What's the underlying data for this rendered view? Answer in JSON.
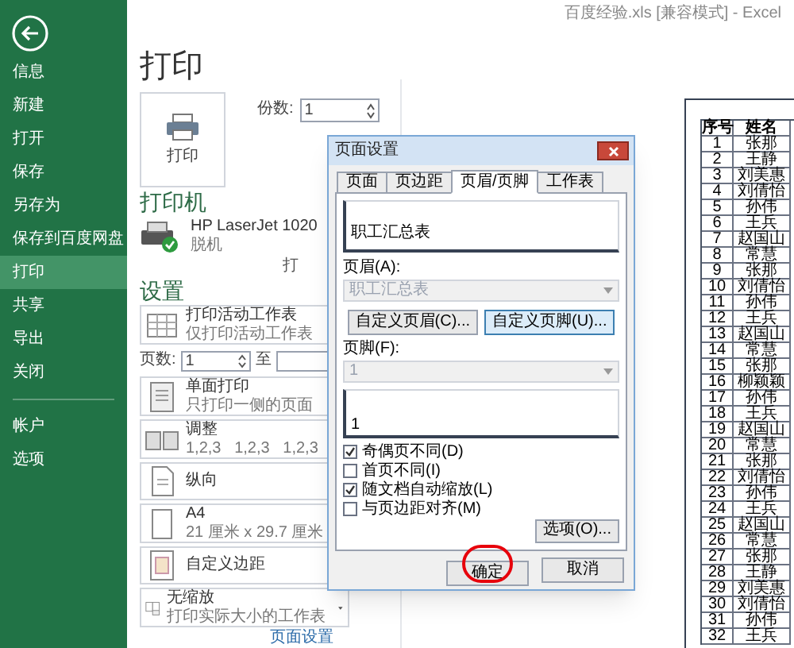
{
  "window": {
    "title": "百度经验.xls [兼容模式] - Excel"
  },
  "backstage_nav": {
    "items": [
      {
        "label": "信息",
        "selected": false
      },
      {
        "label": "新建",
        "selected": false
      },
      {
        "label": "打开",
        "selected": false
      },
      {
        "label": "保存",
        "selected": false
      },
      {
        "label": "另存为",
        "selected": false
      },
      {
        "label": "保存到百度网盘",
        "selected": false
      },
      {
        "label": "打印",
        "selected": true
      },
      {
        "label": "共享",
        "selected": false
      },
      {
        "label": "导出",
        "selected": false
      },
      {
        "label": "关闭",
        "selected": false
      }
    ],
    "lower_items": [
      {
        "label": "帐户",
        "selected": false
      },
      {
        "label": "选项",
        "selected": false
      }
    ]
  },
  "print_panel": {
    "heading": "打印",
    "print_button": "打印",
    "copies": {
      "label": "份数:",
      "value": "1"
    },
    "printer_heading": "打印机",
    "printer": {
      "name": "HP LaserJet 1020",
      "status": "脱机"
    },
    "printer_properties_link": "打",
    "settings_heading": "设置",
    "settings": [
      {
        "kind": "sheet",
        "title": "打印活动工作表",
        "subtitle": "仅打印活动工作表"
      },
      {
        "kind": "pages",
        "label": "页数:",
        "from": "1",
        "to_label": "至"
      },
      {
        "kind": "sides",
        "title": "单面打印",
        "subtitle": "只打印一侧的页面"
      },
      {
        "kind": "collate",
        "title": "调整",
        "subtitle": "1,2,3   1,2,3   1,2,3"
      },
      {
        "kind": "orientation",
        "title": "纵向"
      },
      {
        "kind": "paper",
        "title": "A4",
        "subtitle": "21 厘米 x 29.7 厘米"
      },
      {
        "kind": "margins",
        "title": "自定义边距"
      },
      {
        "kind": "scaling",
        "title": "无缩放",
        "subtitle": "打印实际大小的工作表"
      }
    ],
    "page_setup_link": "页面设置"
  },
  "preview": {
    "table": {
      "columns": [
        "序号",
        "姓名"
      ],
      "rows": [
        [
          "1",
          "张那"
        ],
        [
          "2",
          "王静"
        ],
        [
          "3",
          "刘美惠"
        ],
        [
          "4",
          "刘倩怡"
        ],
        [
          "5",
          "孙伟"
        ],
        [
          "6",
          "王兵"
        ],
        [
          "7",
          "赵国山"
        ],
        [
          "8",
          "常慧"
        ],
        [
          "9",
          "张那"
        ],
        [
          "10",
          "刘倩怡"
        ],
        [
          "11",
          "孙伟"
        ],
        [
          "12",
          "王兵"
        ],
        [
          "13",
          "赵国山"
        ],
        [
          "14",
          "常慧"
        ],
        [
          "15",
          "张那"
        ],
        [
          "16",
          "柳颖颖"
        ],
        [
          "17",
          "孙伟"
        ],
        [
          "18",
          "王兵"
        ],
        [
          "19",
          "赵国山"
        ],
        [
          "20",
          "常慧"
        ],
        [
          "21",
          "张那"
        ],
        [
          "22",
          "刘倩怡"
        ],
        [
          "23",
          "孙伟"
        ],
        [
          "24",
          "王兵"
        ],
        [
          "25",
          "赵国山"
        ],
        [
          "26",
          "常慧"
        ],
        [
          "27",
          "张那"
        ],
        [
          "28",
          "王静"
        ],
        [
          "29",
          "刘美惠"
        ],
        [
          "30",
          "刘倩怡"
        ],
        [
          "31",
          "孙伟"
        ],
        [
          "32",
          "王兵"
        ]
      ]
    }
  },
  "page_setup_dialog": {
    "title": "页面设置",
    "tabs": [
      {
        "label": "页面",
        "selected": false
      },
      {
        "label": "页边距",
        "selected": false
      },
      {
        "label": "页眉/页脚",
        "selected": true
      },
      {
        "label": "工作表",
        "selected": false
      }
    ],
    "header_preview": "职工汇总表",
    "header_label": "页眉(A):",
    "header_combo": {
      "value": "职工汇总表",
      "disabled": true
    },
    "custom_header_button": "自定义页眉(C)...",
    "custom_footer_button": "自定义页脚(U)...",
    "footer_label": "页脚(F):",
    "footer_combo": {
      "value": "1",
      "disabled": true
    },
    "footer_preview": "1",
    "options": [
      {
        "label": "奇偶页不同(D)",
        "checked": true
      },
      {
        "label": "首页不同(I)",
        "checked": false
      },
      {
        "label": "随文档自动缩放(L)",
        "checked": true
      },
      {
        "label": "与页边距对齐(M)",
        "checked": false
      }
    ],
    "options_button": "选项(O)...",
    "ok_button": "确定",
    "cancel_button": "取消"
  }
}
